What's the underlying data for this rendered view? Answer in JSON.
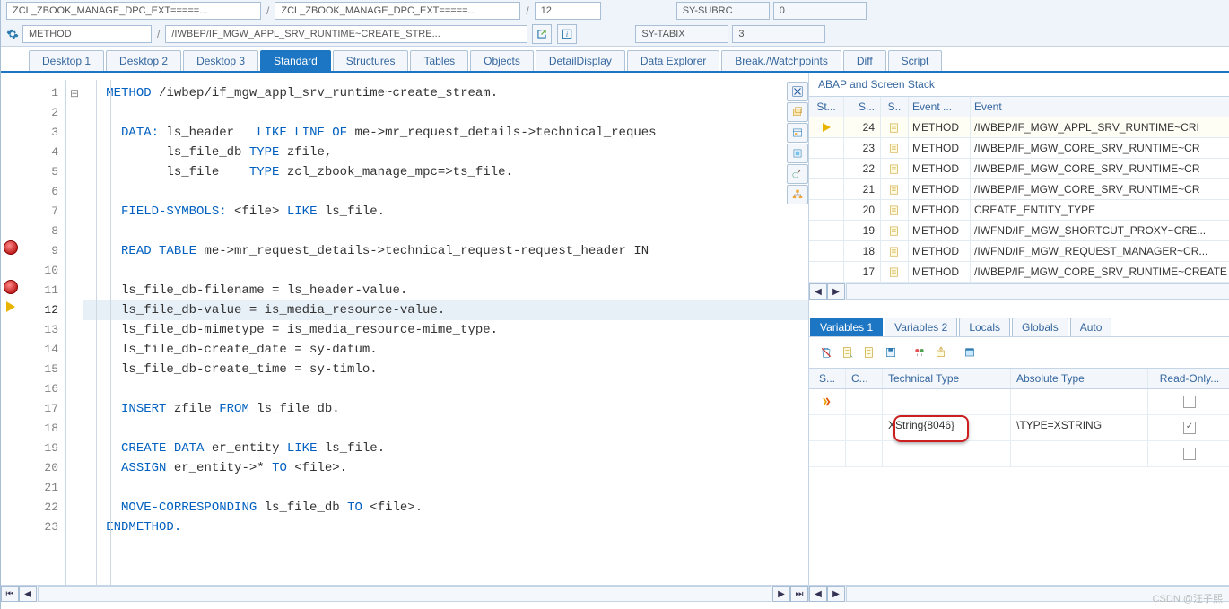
{
  "ctx": {
    "row1": {
      "prog1": "ZCL_ZBOOK_MANAGE_DPC_EXT=====...",
      "prog2": "ZCL_ZBOOK_MANAGE_DPC_EXT=====...",
      "line": "12",
      "sy_subrc_lbl": "SY-SUBRC",
      "sy_subrc": "0"
    },
    "row2": {
      "kind": "METHOD",
      "method": "/IWBEP/IF_MGW_APPL_SRV_RUNTIME~CREATE_STRE...",
      "sy_tabix_lbl": "SY-TABIX",
      "sy_tabix": "3"
    }
  },
  "tabs": [
    "Desktop 1",
    "Desktop 2",
    "Desktop 3",
    "Standard",
    "Structures",
    "Tables",
    "Objects",
    "DetailDisplay",
    "Data Explorer",
    "Break./Watchpoints",
    "Diff",
    "Script"
  ],
  "tabs_active": 3,
  "code": {
    "lines": [
      {
        "n": 1,
        "fold": "⊟",
        "t": "   METHOD /iwbep/if_mgw_appl_srv_runtime~create_stream."
      },
      {
        "n": 2,
        "t": ""
      },
      {
        "n": 3,
        "t": "     DATA: ls_header   LIKE LINE OF me->mr_request_details->technical_reques"
      },
      {
        "n": 4,
        "t": "           ls_file_db TYPE zfile,"
      },
      {
        "n": 5,
        "t": "           ls_file    TYPE zcl_zbook_manage_mpc=>ts_file."
      },
      {
        "n": 6,
        "t": ""
      },
      {
        "n": 7,
        "t": "     FIELD-SYMBOLS: <file> LIKE ls_file."
      },
      {
        "n": 8,
        "t": ""
      },
      {
        "n": 9,
        "bp": true,
        "t": "     READ TABLE me->mr_request_details->technical_request-request_header IN"
      },
      {
        "n": 10,
        "t": ""
      },
      {
        "n": 11,
        "bp": true,
        "t": "     ls_file_db-filename = ls_header-value."
      },
      {
        "n": 12,
        "cur": true,
        "t": "     ls_file_db-value = is_media_resource-value."
      },
      {
        "n": 13,
        "t": "     ls_file_db-mimetype = is_media_resource-mime_type."
      },
      {
        "n": 14,
        "t": "     ls_file_db-create_date = sy-datum."
      },
      {
        "n": 15,
        "t": "     ls_file_db-create_time = sy-timlo."
      },
      {
        "n": 16,
        "t": ""
      },
      {
        "n": 17,
        "t": "     INSERT zfile FROM ls_file_db."
      },
      {
        "n": 18,
        "t": ""
      },
      {
        "n": 19,
        "t": "     CREATE DATA er_entity LIKE ls_file."
      },
      {
        "n": 20,
        "t": "     ASSIGN er_entity->* TO <file>."
      },
      {
        "n": 21,
        "t": ""
      },
      {
        "n": 22,
        "t": "     MOVE-CORRESPONDING ls_file_db TO <file>."
      },
      {
        "n": 23,
        "t": "   ENDMETHOD."
      }
    ]
  },
  "stack": {
    "title": "ABAP and Screen Stack",
    "headers": [
      "St...",
      "S...",
      "S..",
      "Event ...",
      "Event"
    ],
    "rows": [
      {
        "d": 24,
        "cur": true,
        "k": "METHOD",
        "t": "/IWBEP/IF_MGW_APPL_SRV_RUNTIME~CRI"
      },
      {
        "d": 23,
        "k": "METHOD",
        "t": "/IWBEP/IF_MGW_CORE_SRV_RUNTIME~CR"
      },
      {
        "d": 22,
        "k": "METHOD",
        "t": "/IWBEP/IF_MGW_CORE_SRV_RUNTIME~CR"
      },
      {
        "d": 21,
        "k": "METHOD",
        "t": "/IWBEP/IF_MGW_CORE_SRV_RUNTIME~CR"
      },
      {
        "d": 20,
        "k": "METHOD",
        "t": "CREATE_ENTITY_TYPE"
      },
      {
        "d": 19,
        "k": "METHOD",
        "t": "/IWFND/IF_MGW_SHORTCUT_PROXY~CRE..."
      },
      {
        "d": 18,
        "k": "METHOD",
        "t": "/IWFND/IF_MGW_REQUEST_MANAGER~CR..."
      },
      {
        "d": 17,
        "k": "METHOD",
        "t": "/IWBEP/IF_MGW_CORE_SRV_RUNTIME~CREATE"
      }
    ]
  },
  "vars": {
    "tabs": [
      "Variables 1",
      "Variables 2",
      "Locals",
      "Globals",
      "Auto"
    ],
    "tabs_active": 0,
    "headers": {
      "s": "S...",
      "c": "C...",
      "tt": "Technical Type",
      "at": "Absolute Type",
      "ro": "Read-Only..."
    },
    "rows": [
      {
        "chg": true,
        "tt": "",
        "at": "",
        "ro": false
      },
      {
        "tt": "XString{8046}",
        "at": "\\TYPE=XSTRING",
        "ro": true
      },
      {
        "tt": "",
        "at": "",
        "ro": false
      }
    ],
    "highlight": "ng{8046}"
  },
  "watermark": "CSDN @汪子熙"
}
